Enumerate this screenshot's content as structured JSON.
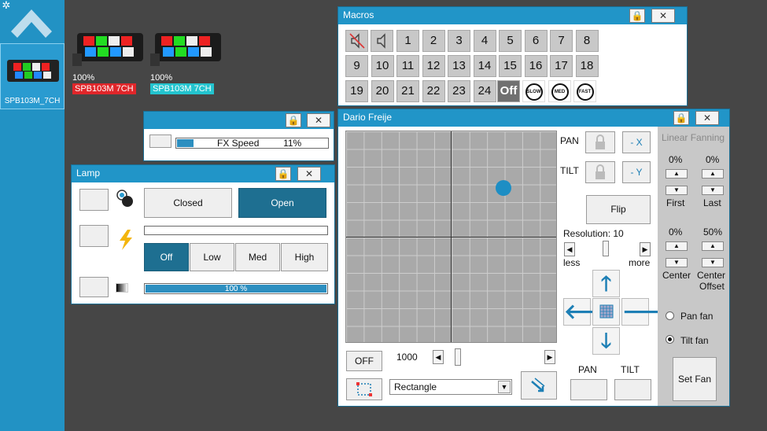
{
  "sidebar": {
    "fixture_label": "SPB103M_7CH"
  },
  "fixtures": [
    {
      "percent": "100%",
      "name": "SPB103M 7CH",
      "tag_color": "#e0262a"
    },
    {
      "percent": "100%",
      "name": "SPB103M 7CH",
      "tag_color": "#23c4cf"
    }
  ],
  "fx_window": {
    "label": "FX Speed",
    "value_text": "11%",
    "value": 0.11
  },
  "lamp": {
    "title": "Lamp",
    "shutter": {
      "closed": "Closed",
      "open": "Open",
      "selected": "Open"
    },
    "power_levels": [
      "Off",
      "Low",
      "Med",
      "High"
    ],
    "power_selected": "Off",
    "dimmer_text": "100 %",
    "dimmer_value": 1.0
  },
  "macros": {
    "title": "Macros",
    "row1": [
      "1",
      "2",
      "3",
      "4",
      "5",
      "6",
      "7",
      "8"
    ],
    "row2": [
      "9",
      "10",
      "11",
      "12",
      "13",
      "14",
      "15",
      "16",
      "17",
      "18"
    ],
    "row3": [
      "19",
      "20",
      "21",
      "22",
      "23",
      "24"
    ],
    "off_label": "Off",
    "speeds": [
      "SLOW",
      "MED",
      "FAST"
    ]
  },
  "dario": {
    "title": "Dario Freije",
    "pan_label": "PAN",
    "tilt_label": "TILT",
    "neg_x": "- X",
    "neg_y": "- Y",
    "flip": "Flip",
    "resolution_label": "Resolution: 10",
    "less": "less",
    "more": "more",
    "off_button": "OFF",
    "speed_value": "1000",
    "shape_selected": "Rectangle",
    "pan_bottom_label": "PAN",
    "tilt_bottom_label": "TILT",
    "dot_pan": 0.75,
    "dot_tilt": 0.27
  },
  "fanning": {
    "title": "Linear Fanning",
    "first_value": "0%",
    "last_value": "0%",
    "first_label": "First",
    "last_label": "Last",
    "center_value": "0%",
    "offset_value": "50%",
    "center_label": "Center",
    "offset_label_1": "Center",
    "offset_label_2": "Offset",
    "pan_fan": "Pan fan",
    "tilt_fan": "Tilt fan",
    "selected_fan": "Tilt fan",
    "set_fan": "Set Fan"
  },
  "colors": {
    "accent": "#2195c8",
    "selected": "#1e6f91"
  }
}
